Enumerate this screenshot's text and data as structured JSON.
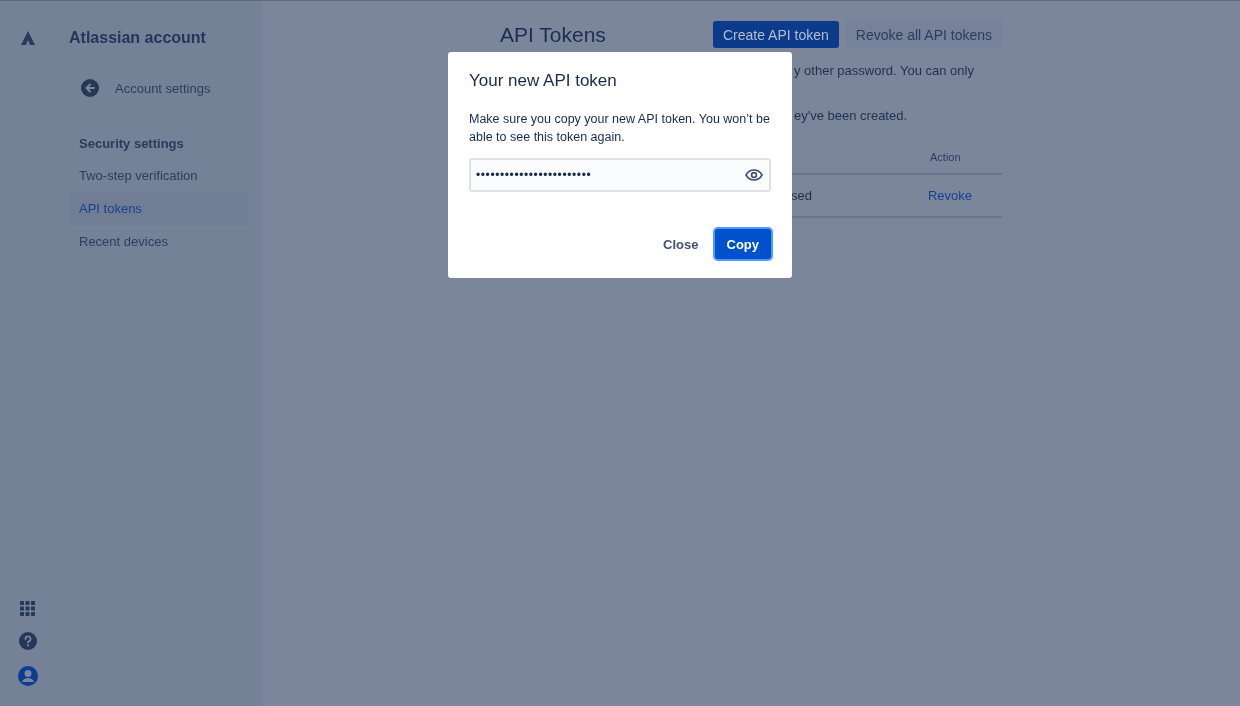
{
  "sidebar": {
    "title": "Atlassian account",
    "back_link": "Account settings",
    "section_heading": "Security settings",
    "items": [
      {
        "label": "Two-step verification",
        "selected": false
      },
      {
        "label": "API tokens",
        "selected": true
      },
      {
        "label": "Recent devices",
        "selected": false
      }
    ]
  },
  "page": {
    "title": "API Tokens",
    "buttons": [
      {
        "label": "Create API token",
        "kind": "primary"
      },
      {
        "label": "Revoke all API tokens",
        "kind": "subtle"
      }
    ],
    "description_fragments": [
      "y other password. You can only",
      "ey've been created."
    ],
    "table": {
      "header": "Action",
      "row_fragment": "sed",
      "row_action": "Revoke"
    }
  },
  "dialog": {
    "title": "Your new API token",
    "message": "Make sure you copy your new API token. You won’t be able to see this token again.",
    "token_value": "••••••••••••••••••••••••",
    "buttons": [
      {
        "label": "Close",
        "kind": "subtle"
      },
      {
        "label": "Copy",
        "kind": "primary"
      }
    ]
  }
}
